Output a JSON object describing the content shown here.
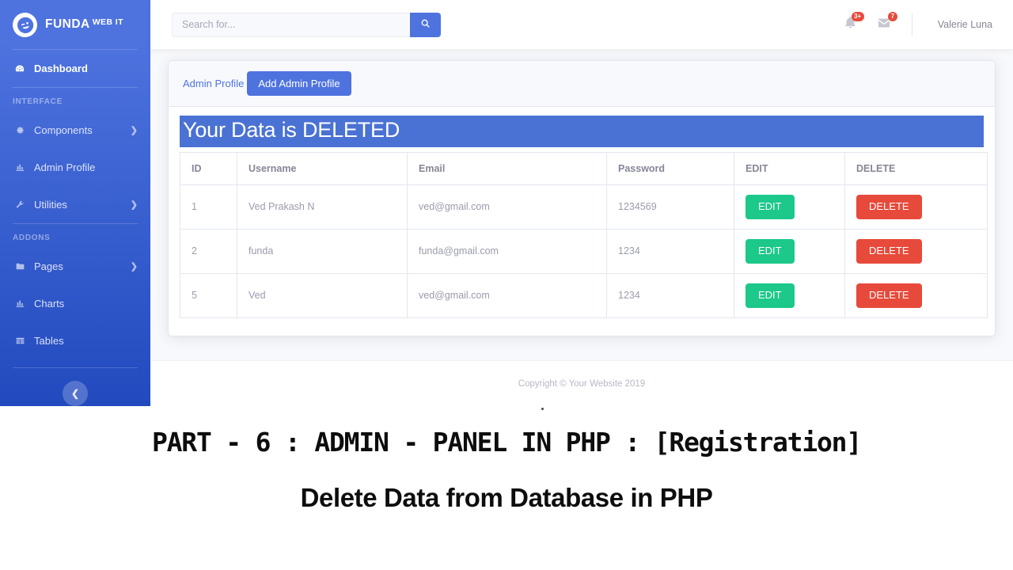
{
  "brand": {
    "icon": "laugh-wink-icon",
    "name": "FUNDA",
    "suffix": "WEB IT"
  },
  "sidebar": {
    "items": [
      {
        "id": "dashboard",
        "label": "Dashboard",
        "icon": "tachometer-icon",
        "active": true,
        "caret": false
      },
      {
        "id": "components",
        "label": "Components",
        "icon": "cog-icon",
        "active": false,
        "caret": true
      },
      {
        "id": "admin-profile",
        "label": "Admin Profile",
        "icon": "chart-area-icon",
        "active": false,
        "caret": false
      },
      {
        "id": "utilities",
        "label": "Utilities",
        "icon": "wrench-icon",
        "active": false,
        "caret": true
      },
      {
        "id": "pages",
        "label": "Pages",
        "icon": "folder-icon",
        "active": false,
        "caret": true
      },
      {
        "id": "charts",
        "label": "Charts",
        "icon": "chart-area-icon",
        "active": false,
        "caret": false
      },
      {
        "id": "tables",
        "label": "Tables",
        "icon": "table-icon",
        "active": false,
        "caret": false
      }
    ],
    "heading_interface": "INTERFACE",
    "heading_addons": "ADDONS",
    "toggle_icon": "chevron-left-icon",
    "bg_color": "#4e73df"
  },
  "topbar": {
    "search": {
      "value": "",
      "placeholder": "Search for...",
      "button_icon": "search-icon"
    },
    "alerts": {
      "icon": "bell-icon",
      "badge": "3+"
    },
    "messages": {
      "icon": "envelope-icon",
      "badge": "7"
    },
    "user": {
      "name": "Valerie Luna"
    }
  },
  "card": {
    "header": {
      "breadcrumb_label": "Admin Profile",
      "add_button_label": "Add Admin Profile"
    },
    "alert": {
      "message": "Your Data is DELETED",
      "color": "#4a72d4"
    },
    "table": {
      "columns": [
        "ID",
        "Username",
        "Email",
        "Password",
        "EDIT",
        "DELETE"
      ],
      "edit_label": "EDIT",
      "delete_label": "DELETE",
      "edit_color": "#1cc88a",
      "delete_color": "#e74a3b",
      "rows": [
        {
          "id": "1",
          "username": "Ved Prakash N",
          "email": "ved@gmail.com",
          "password": "1234569"
        },
        {
          "id": "2",
          "username": "funda",
          "email": "funda@gmail.com",
          "password": "1234"
        },
        {
          "id": "5",
          "username": "Ved",
          "email": "ved@gmail.com",
          "password": "1234"
        }
      ]
    }
  },
  "footer": {
    "copyright": "Copyright © Your Website 2019"
  },
  "caption": {
    "line1": "PART - 6 : ADMIN - PANEL IN PHP : [Registration]",
    "line2": "Delete Data from Database in PHP"
  }
}
